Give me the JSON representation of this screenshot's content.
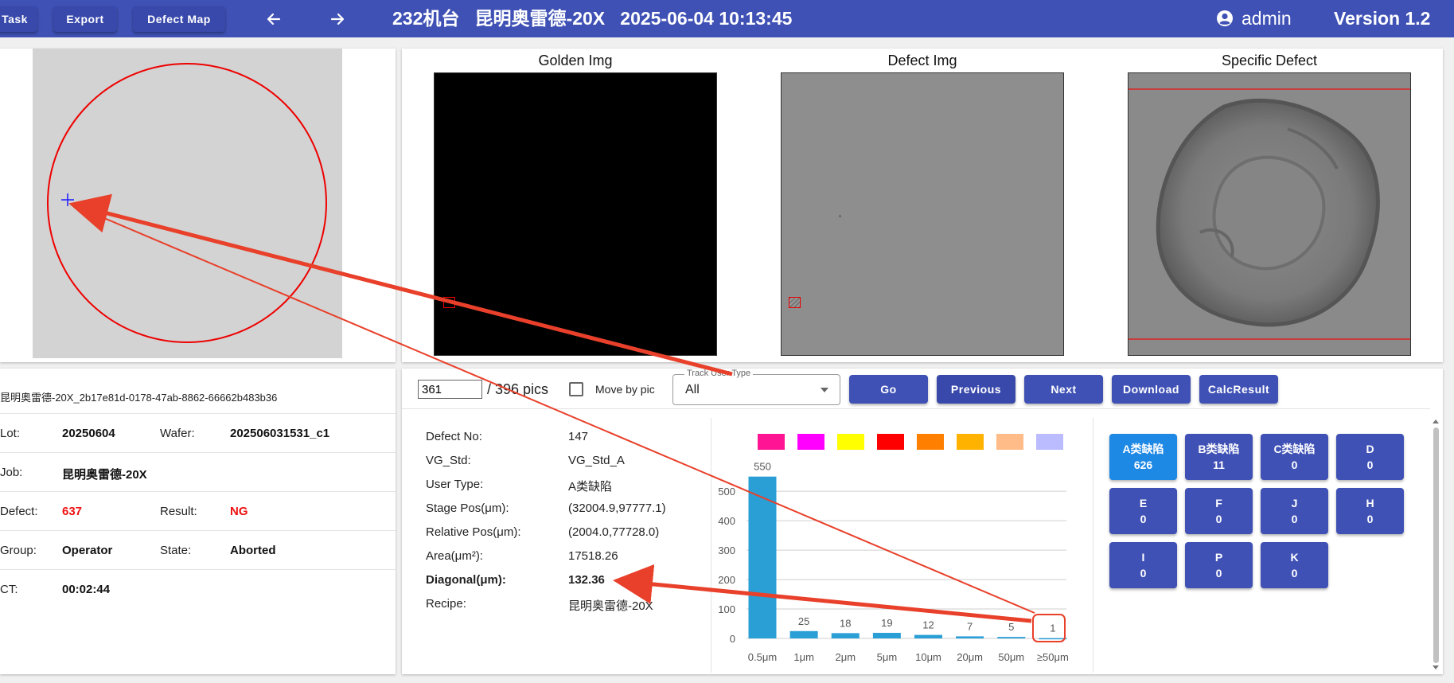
{
  "header": {
    "task_label": "Task",
    "export_label": "Export",
    "defect_map_label": "Defect Map",
    "title": "232机台   昆明奥雷德-20X   2025-06-04 10:13:45",
    "user": "admin",
    "version": "Version 1.2",
    "color": "#3f51b5"
  },
  "images": {
    "golden_title": "Golden Img",
    "defect_title": "Defect Img",
    "specific_title": "Specific Defect"
  },
  "info": {
    "file_name": "昆明奥雷德-20X_2b17e81d-0178-47ab-8862-66662b483b36",
    "lot_label": "Lot:",
    "lot_value": "20250604",
    "wafer_label": "Wafer:",
    "wafer_value": "202506031531_c1",
    "job_label": "Job:",
    "job_value": "昆明奥雷德-20X",
    "defect_label": "Defect:",
    "defect_value": "637",
    "result_label": "Result:",
    "result_value": "NG",
    "group_label": "Group:",
    "group_value": "Operator",
    "state_label": "State:",
    "state_value": "Aborted",
    "ct_label": "CT:",
    "ct_value": "00:02:44"
  },
  "controls": {
    "pic_index": "361",
    "pic_total": "/ 396 pics",
    "move_by_pic": "Move by pic",
    "track_label": "Track User Type",
    "track_value": "All",
    "go": "Go",
    "previous": "Previous",
    "next": "Next",
    "download": "Download",
    "calc": "CalcResult"
  },
  "details": {
    "rows": [
      {
        "label": "Defect No:",
        "value": "147"
      },
      {
        "label": "VG_Std:",
        "value": "VG_Std_A"
      },
      {
        "label": "User Type:",
        "value": "A类缺陷"
      },
      {
        "label": "Stage Pos(μm):",
        "value": "(32004.9,97777.1)"
      },
      {
        "label": "Relative Pos(μm):",
        "value": "(2004.0,77728.0)"
      },
      {
        "label": "Area(μm²):",
        "value": "17518.26"
      },
      {
        "label": "Diagonal(μm):",
        "value": "132.36"
      },
      {
        "label": "Recipe:",
        "value": "昆明奥雷德-20X"
      }
    ]
  },
  "legend_colors": [
    "#ff1493",
    "#ff00ff",
    "#ffff00",
    "#ff0000",
    "#ff8000",
    "#ffb300",
    "#ffbb88",
    "#bbbbff"
  ],
  "chart_data": {
    "type": "bar",
    "categories": [
      "0.5μm",
      "1μm",
      "2μm",
      "5μm",
      "10μm",
      "20μm",
      "50μm",
      "≥50μm"
    ],
    "values": [
      550,
      25,
      18,
      19,
      12,
      7,
      5,
      1
    ],
    "y_ticks": [
      0,
      100,
      200,
      300,
      400,
      500
    ],
    "ylim": [
      0,
      560
    ],
    "grid": true,
    "bar_color": "#2a9fd6"
  },
  "categories": [
    {
      "name": "A类缺陷",
      "count": "626",
      "active": true
    },
    {
      "name": "B类缺陷",
      "count": "11"
    },
    {
      "name": "C类缺陷",
      "count": "0"
    },
    {
      "name": "D",
      "count": "0"
    },
    {
      "name": "E",
      "count": "0"
    },
    {
      "name": "F",
      "count": "0"
    },
    {
      "name": "J",
      "count": "0"
    },
    {
      "name": "H",
      "count": "0"
    },
    {
      "name": "I",
      "count": "0"
    },
    {
      "name": "P",
      "count": "0"
    },
    {
      "name": "K",
      "count": "0"
    }
  ]
}
